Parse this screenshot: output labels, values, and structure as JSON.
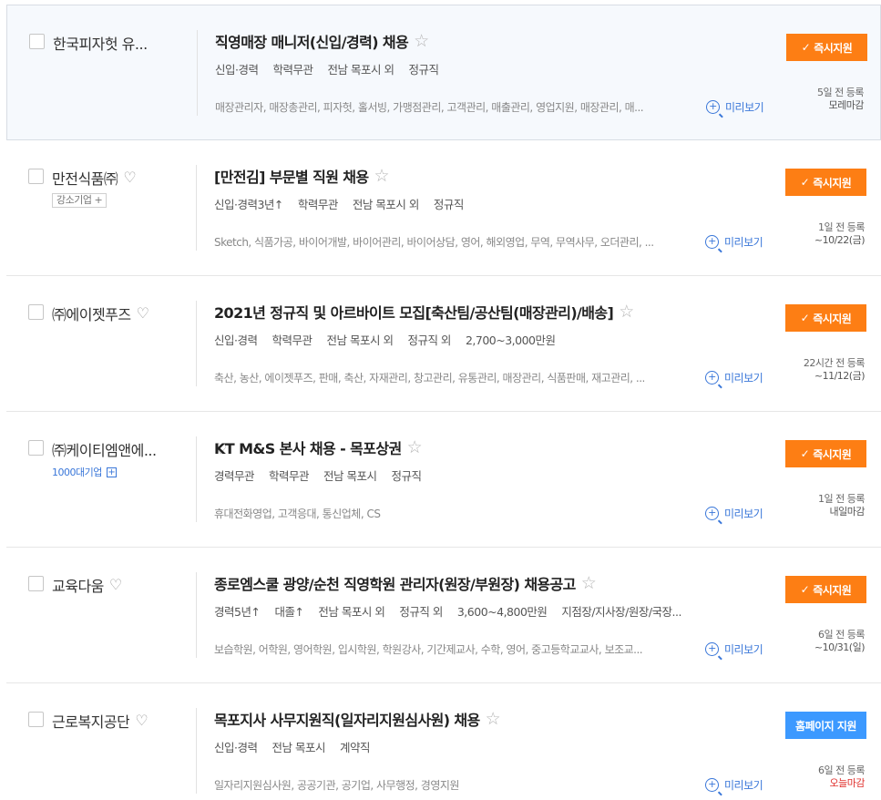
{
  "labels": {
    "preview": "미리보기",
    "apply_icon": "✓"
  },
  "jobs": [
    {
      "company": "한국피자헛 유...",
      "title": "직영매장 매니저(신입/경력) 채용",
      "meta": [
        "신입·경력",
        "학력무관",
        "전남 목포시 외",
        "정규직"
      ],
      "tags": "매장관리자, 매장총관리, 피자헛, 홀서빙, 가맹점관리, 고객관리, 매출관리, 영업지원, 매장관리, 매...",
      "apply_label": "즉시지원",
      "posted": "5일 전 등록",
      "deadline": "모레마감"
    },
    {
      "company": "만전식품㈜",
      "badge": "강소기업 +",
      "title": "[만전김] 부문별 직원 채용",
      "meta": [
        "신입·경력3년↑",
        "학력무관",
        "전남 목포시 외",
        "정규직"
      ],
      "tags": "Sketch, 식품가공, 바이어개발, 바이어관리, 바이어상담, 영어, 해외영업, 무역, 무역사무, 오더관리, ...",
      "apply_label": "즉시지원",
      "posted": "1일 전 등록",
      "deadline": "~10/22(금)"
    },
    {
      "company": "㈜에이젯푸즈",
      "title": "2021년 정규직 및 아르바이트 모집[축산팀/공산팀(매장관리)/배송]",
      "meta": [
        "신입·경력",
        "학력무관",
        "전남 목포시 외",
        "정규직 외",
        "2,700~3,000만원"
      ],
      "tags": "축산, 농산, 에이젯푸즈, 판매, 축산, 자재관리, 창고관리, 유통관리, 매장관리, 식품판매, 재고관리, ...",
      "apply_label": "즉시지원",
      "posted": "22시간 전 등록",
      "deadline": "~11/12(금)"
    },
    {
      "company": "㈜케이티엠앤에...",
      "badge_blue": "1000대기업",
      "badge_blue_icon": "+",
      "title": "KT M&S 본사 채용 - 목포상권",
      "meta": [
        "경력무관",
        "학력무관",
        "전남 목포시",
        "정규직"
      ],
      "tags": "휴대전화영업, 고객응대, 통신업체, CS",
      "apply_label": "즉시지원",
      "posted": "1일 전 등록",
      "deadline": "내일마감"
    },
    {
      "company": "교육다움",
      "title": "종로엠스쿨 광양/순천 직영학원 관리자(원장/부원장) 채용공고",
      "meta": [
        "경력5년↑",
        "대졸↑",
        "전남 목포시 외",
        "정규직 외",
        "3,600~4,800만원",
        "지점장/지사장/원장/국장..."
      ],
      "tags": "보습학원, 어학원, 영어학원, 입시학원, 학원강사, 기간제교사, 수학, 영어, 중고등학교교사, 보조교...",
      "apply_label": "즉시지원",
      "posted": "6일 전 등록",
      "deadline": "~10/31(일)"
    },
    {
      "company": "근로복지공단",
      "title": "목포지사 사무지원직(일자리지원심사원) 채용",
      "meta": [
        "신입·경력",
        "전남 목포시",
        "계약직"
      ],
      "tags": "일자리지원심사원, 공공기관, 공기업, 사무행정, 경영지원",
      "apply_label": "홈페이지 지원",
      "posted": "6일 전 등록",
      "deadline": "오늘마감"
    }
  ],
  "colors": {
    "apply_orange": "#fd7e14",
    "apply_blue": "#3c99ff",
    "link_blue": "#3a77d9",
    "deadline_red": "#e0312e"
  },
  "icons": {
    "favorite": "heart-outline-icon",
    "scrap": "star-outline-icon",
    "preview": "magnifier-plus-icon",
    "apply": "check-icon"
  }
}
